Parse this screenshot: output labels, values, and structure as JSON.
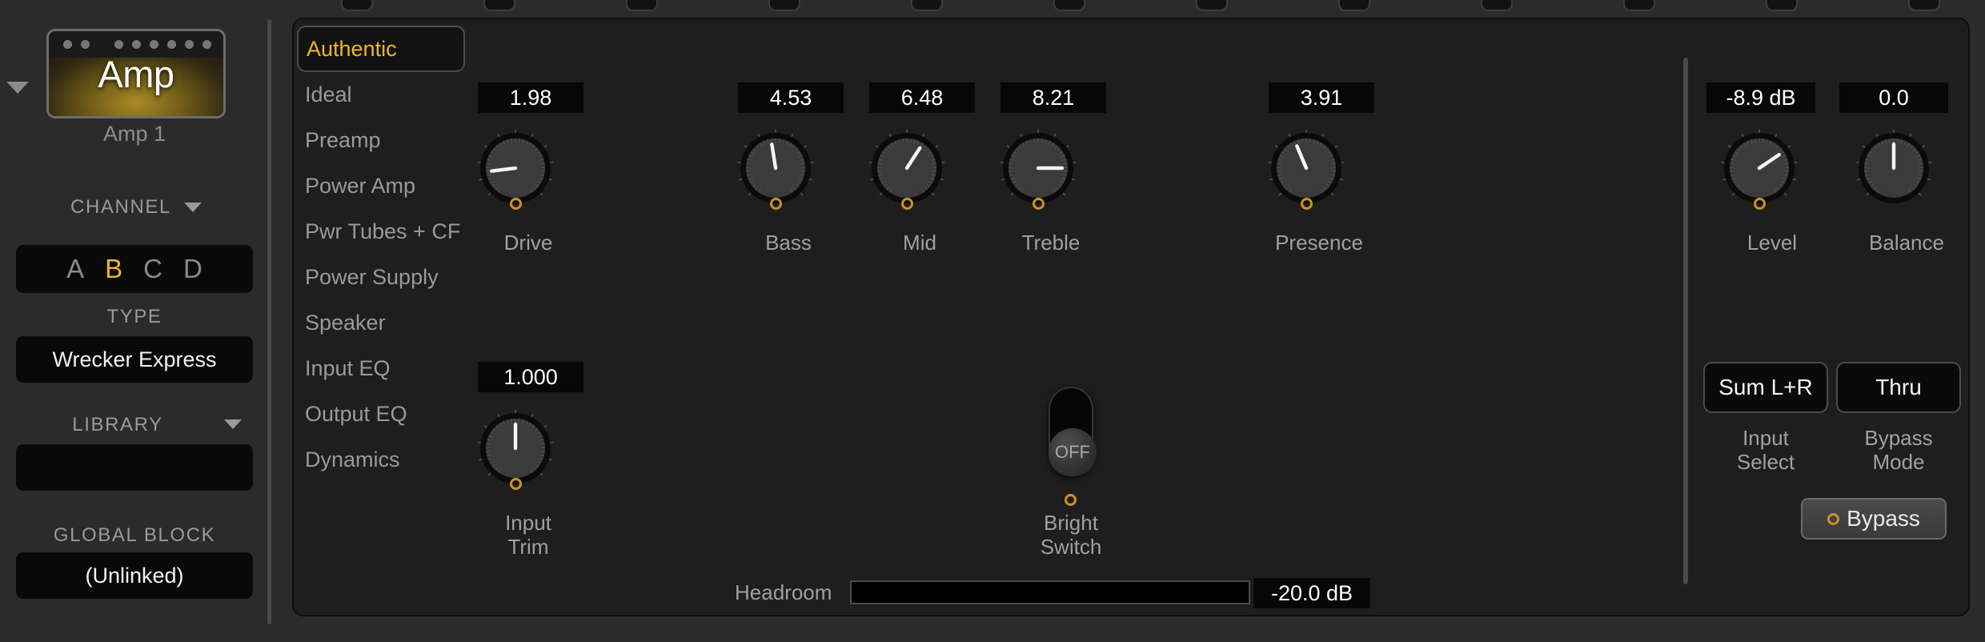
{
  "sidebar": {
    "collapse_icon": "chevron-down-icon",
    "amp_thumbnail_label": "Amp",
    "amp_name": "Amp 1",
    "channel": {
      "label": "CHANNEL",
      "caret_icon": "chevron-down-icon",
      "options": [
        "A",
        "B",
        "C",
        "D"
      ],
      "selected": "B"
    },
    "type": {
      "label": "TYPE",
      "value": "Wrecker Express"
    },
    "library": {
      "label": "LIBRARY",
      "caret_icon": "chevron-down-icon",
      "value": ""
    },
    "global_block": {
      "label": "GLOBAL BLOCK",
      "value": "(Unlinked)"
    }
  },
  "tabs": [
    {
      "label": "Authentic",
      "active": true
    },
    {
      "label": "Ideal",
      "active": false
    },
    {
      "label": "Preamp",
      "active": false
    },
    {
      "label": "Power Amp",
      "active": false
    },
    {
      "label": "Pwr Tubes + CF",
      "active": false
    },
    {
      "label": "Power Supply",
      "active": false
    },
    {
      "label": "Speaker",
      "active": false
    },
    {
      "label": "Input EQ",
      "active": false
    },
    {
      "label": "Output EQ",
      "active": false
    },
    {
      "label": "Dynamics",
      "active": false
    }
  ],
  "knobs": [
    {
      "name": "drive",
      "label": "Drive",
      "value": "1.98",
      "angle": -97,
      "has_orange_dot": true
    },
    {
      "name": "bass",
      "label": "Bass",
      "value": "4.53",
      "angle": -9,
      "has_orange_dot": true
    },
    {
      "name": "mid",
      "label": "Mid",
      "value": "6.48",
      "angle": 33,
      "has_orange_dot": true
    },
    {
      "name": "treble",
      "label": "Treble",
      "value": "8.21",
      "angle": 90,
      "has_orange_dot": true
    },
    {
      "name": "presence",
      "label": "Presence",
      "value": "3.91",
      "angle": -23,
      "has_orange_dot": true
    },
    {
      "name": "level",
      "label": "Level",
      "value": "-8.9 dB",
      "angle": 56,
      "has_orange_dot": true
    },
    {
      "name": "balance",
      "label": "Balance",
      "value": "0.0",
      "angle": 0,
      "has_orange_dot": false
    },
    {
      "name": "input-trim",
      "label": "Input\nTrim",
      "value": "1.000",
      "angle": 0,
      "has_orange_dot": true
    }
  ],
  "bright_switch": {
    "label": "Bright\nSwitch",
    "state": "OFF",
    "has_orange_dot": true
  },
  "headroom": {
    "label": "Headroom",
    "value": "-20.0 dB",
    "fill_percent": 0
  },
  "right_controls": {
    "input_select": {
      "caption": "Input\nSelect",
      "value": "Sum L+R"
    },
    "bypass_mode": {
      "caption": "Bypass\nMode",
      "value": "Thru"
    },
    "bypass_button": {
      "label": "Bypass",
      "indicator_icon": "ring-icon"
    }
  },
  "colors": {
    "accent": "#f0b429",
    "orange_ring": "#c8912a",
    "panel_bg": "#1e1e1e",
    "app_bg": "#2b2b2b",
    "field_bg": "#090909",
    "text_muted": "#9a9a9a"
  }
}
